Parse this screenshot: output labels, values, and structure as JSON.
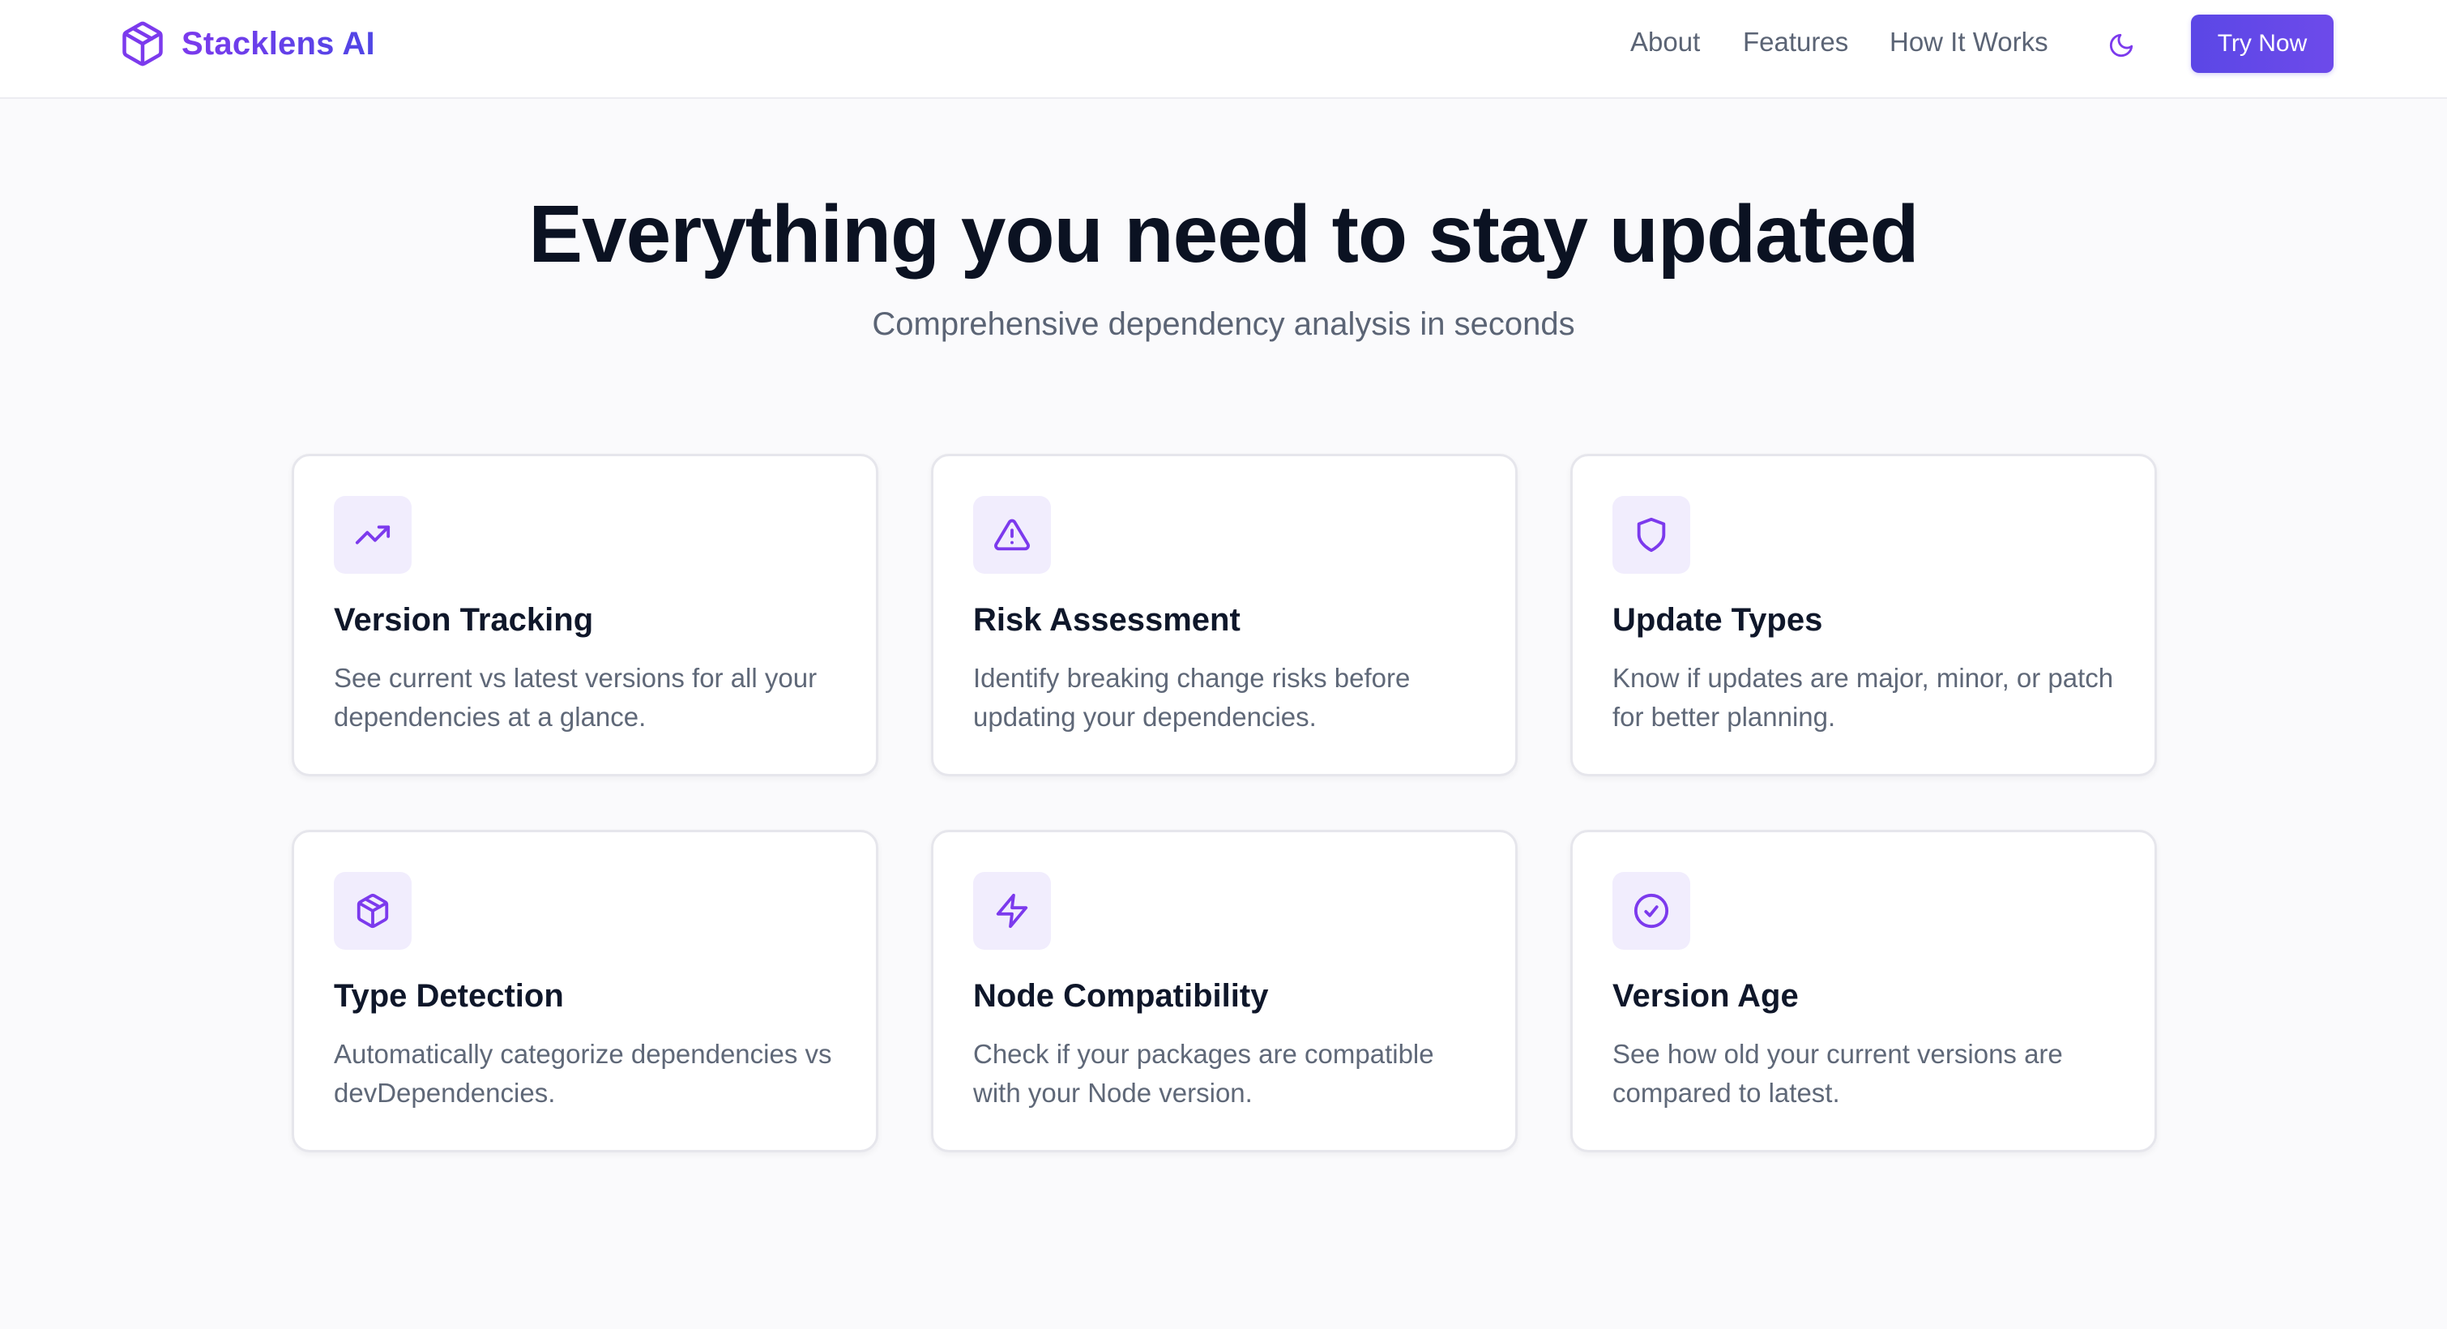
{
  "brand": {
    "name": "Stacklens AI",
    "icon": "cube-icon"
  },
  "nav": {
    "links": [
      {
        "label": "About"
      },
      {
        "label": "Features"
      },
      {
        "label": "How It Works"
      }
    ],
    "theme_toggle_icon": "moon-icon",
    "cta_label": "Try Now"
  },
  "hero": {
    "title": "Everything you need to stay updated",
    "subtitle": "Comprehensive dependency analysis in seconds"
  },
  "features": [
    {
      "icon": "trending-up-icon",
      "title": "Version Tracking",
      "description": "See current vs latest versions for all your dependencies at a glance."
    },
    {
      "icon": "alert-triangle-icon",
      "title": "Risk Assessment",
      "description": "Identify breaking change risks before updating your dependencies."
    },
    {
      "icon": "shield-icon",
      "title": "Update Types",
      "description": "Know if updates are major, minor, or patch for better planning."
    },
    {
      "icon": "package-icon",
      "title": "Type Detection",
      "description": "Automatically categorize dependencies vs devDependencies."
    },
    {
      "icon": "lightning-icon",
      "title": "Node Compatibility",
      "description": "Check if your packages are compatible with your Node version."
    },
    {
      "icon": "check-circle-icon",
      "title": "Version Age",
      "description": "See how old your current versions are compared to latest."
    }
  ],
  "colors": {
    "accent": "#7c3aed",
    "cta": "#5b47e6",
    "icon_bg": "#f1edfd"
  }
}
